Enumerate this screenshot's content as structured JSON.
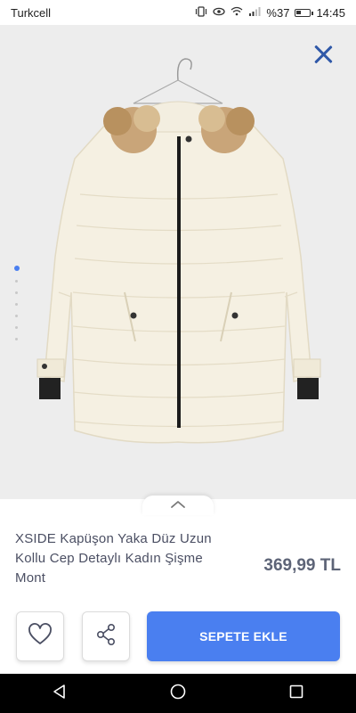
{
  "status_bar": {
    "carrier": "Turkcell",
    "battery_percent": "%37",
    "time": "14:45",
    "icons": [
      "vibrate-icon",
      "eye-comfort-icon",
      "wifi-icon",
      "signal-icon",
      "battery-icon"
    ],
    "battery_level": 0.37
  },
  "gallery": {
    "image_count": 7,
    "active_index": 0,
    "image_description": "Cream hooded puffer coat with fur trim on hanger"
  },
  "product": {
    "title": "XSIDE Kapüşon Yaka Düz Uzun Kollu Cep Detaylı Kadın Şişme Mont",
    "price": "369,99 TL"
  },
  "actions": {
    "add_to_cart_label": "SEPETE EKLE"
  },
  "colors": {
    "accent": "#4a7ff0",
    "close_icon": "#2f58a8",
    "text": "#4b4f63"
  }
}
